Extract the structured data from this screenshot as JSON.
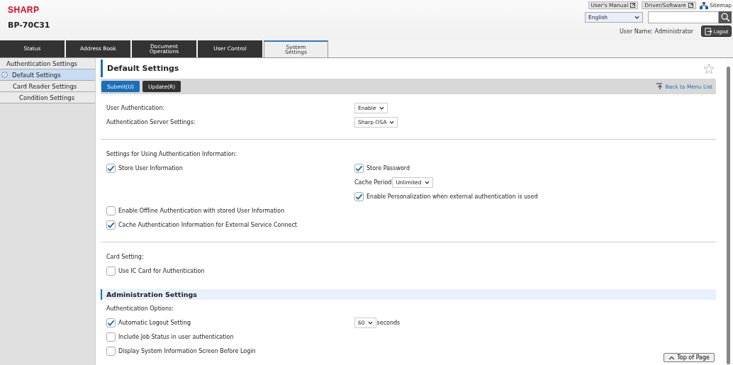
{
  "header": {
    "logo": "SHARP",
    "model": "BP-70C31",
    "links": [
      {
        "label": "User's Manual",
        "kind": "external"
      },
      {
        "label": "Driver/Software",
        "kind": "external"
      },
      {
        "label": "Sitemap",
        "kind": "sitemap"
      }
    ],
    "language": "English",
    "user_name": "User Name: Administrator",
    "logout": "Logout"
  },
  "tabs": [
    {
      "label": "Status",
      "selected": false
    },
    {
      "label": "Address Book",
      "selected": false
    },
    {
      "label": "Document Operations",
      "selected": false
    },
    {
      "label": "User Control",
      "selected": false
    },
    {
      "label": "System Settings",
      "selected": true
    }
  ],
  "sidebar": {
    "items": [
      {
        "label": "Authentication Settings",
        "selected": false,
        "children": [
          {
            "label": "Default Settings",
            "selected": true
          },
          {
            "label": "Card Reader Settings",
            "selected": false,
            "children": [
              {
                "label": "Condition Settings",
                "selected": false
              }
            ]
          }
        ]
      }
    ]
  },
  "page": {
    "title": "Default Settings",
    "buttons": [
      {
        "label": "Submit(U)",
        "kind": "primary"
      },
      {
        "label": "Update(R)",
        "kind": "secondary"
      }
    ],
    "back_link": "Back to Menu List",
    "blocks": [
      {
        "kind": "row",
        "left": {
          "kind": "text",
          "label": "User Authentication:"
        },
        "right": {
          "kind": "select",
          "value": "Enable"
        }
      },
      {
        "kind": "row",
        "left": {
          "kind": "text",
          "label": "Authentication Server Settings:"
        },
        "right": {
          "kind": "select",
          "value": "Sharp OSA"
        }
      },
      {
        "kind": "divider"
      },
      {
        "kind": "row",
        "left": {
          "kind": "text",
          "label": "Settings for Using Authentication Information:"
        }
      },
      {
        "kind": "row",
        "left": {
          "kind": "check",
          "label": "Store User Information",
          "checked": true
        },
        "right": {
          "kind": "check",
          "label": "Store Password",
          "checked": true
        }
      },
      {
        "kind": "row",
        "right": {
          "kind": "caption_select",
          "label": "Cache Period",
          "value": "Unlimited"
        }
      },
      {
        "kind": "row",
        "right": {
          "kind": "check",
          "label": "Enable Personalization when external authentication is used",
          "checked": true
        }
      },
      {
        "kind": "row",
        "left": {
          "kind": "check",
          "label": "Enable Offline Authentication with stored User Information",
          "checked": false
        }
      },
      {
        "kind": "row",
        "left": {
          "kind": "check",
          "label": "Cache Authentication Information for External Service Connect",
          "checked": true
        }
      },
      {
        "kind": "divider"
      },
      {
        "kind": "row",
        "left": {
          "kind": "text",
          "label": "Card Setting:"
        }
      },
      {
        "kind": "row",
        "left": {
          "kind": "check",
          "label": "Use IC Card for Authentication",
          "checked": false
        }
      },
      {
        "kind": "heading",
        "label": "Administration Settings"
      },
      {
        "kind": "row",
        "left": {
          "kind": "text",
          "label": "Authentication Options:"
        }
      },
      {
        "kind": "row",
        "left": {
          "kind": "check",
          "label": "Automatic Logout Setting",
          "checked": true
        },
        "right": {
          "kind": "select_suffix",
          "value": "60",
          "suffix": "seconds"
        }
      },
      {
        "kind": "row",
        "left": {
          "kind": "check",
          "label": "Include Job Status in user authentication",
          "checked": false
        }
      },
      {
        "kind": "row",
        "left": {
          "kind": "check",
          "label": "Display System Information Screen Before Login",
          "checked": false
        }
      }
    ],
    "top_button": "Top of Page"
  }
}
